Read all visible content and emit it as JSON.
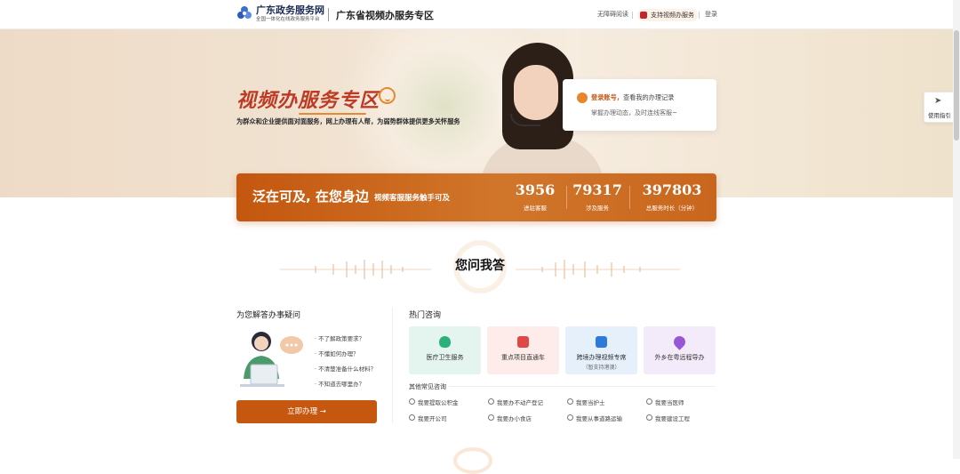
{
  "header": {
    "site_name": "广东政务服务网",
    "site_tagline": "全国一体化在线政务服务平台",
    "zone_title": "广东省视频办服务专区",
    "links": {
      "accessibility": "无障碍阅读",
      "video_support": "支持视频办服务",
      "login": "登录"
    }
  },
  "hero": {
    "title": "视频办服务专区",
    "subtitle": "为群众和企业提供面对面服务，网上办理有人帮，为弱势群体提供更多关怀服务"
  },
  "login_card": {
    "highlight": "登录账号，",
    "line1_rest": "查看我的办理记录",
    "line2": "掌握办理动态，及时连线客服~"
  },
  "stats": {
    "slogan": "泛在可及, 在您身边",
    "tagline": "视频客服服务触手可及",
    "items": [
      {
        "value": "3956",
        "label": "进驻客服"
      },
      {
        "value": "79317",
        "label": "涉及服务"
      },
      {
        "value": "397803",
        "label": "总服务时长（分钟）"
      }
    ]
  },
  "qa": {
    "title": "您问我答",
    "left_heading": "为您解答办事疑问",
    "questions": [
      "不了解政策要求？",
      "不懂如何办理？",
      "不清楚准备什么材料？",
      "不知道去哪里办？"
    ],
    "action_button": "立即办理 →"
  },
  "hot": {
    "heading": "热门咨询",
    "cards": [
      {
        "title": "医疗卫生服务",
        "sub": "",
        "bg": "#e4f4ef",
        "icon_color": "#2bb07a",
        "icon": "medical-shield-icon"
      },
      {
        "title": "重点项目直通车",
        "sub": "",
        "bg": "#fdecea",
        "icon_color": "#e04848",
        "icon": "project-book-icon"
      },
      {
        "title": "跨境办理视频专席",
        "sub": "（暂支持港澳）",
        "bg": "#e6f0fb",
        "icon_color": "#2f7ad9",
        "icon": "crossborder-document-icon"
      },
      {
        "title": "外乡在粤远程导办",
        "sub": "",
        "bg": "#f3ebfa",
        "icon_color": "#9656d6",
        "icon": "location-pin-icon"
      }
    ],
    "other_heading": "其他常见咨询",
    "other_items": [
      "我要提取公积金",
      "我要办不动产登记",
      "我要当护士",
      "我要当医师",
      "我要开公司",
      "我要办小食店",
      "我要从事道路运输",
      "我要建设工程"
    ]
  },
  "side_guide": {
    "label": "使用指引",
    "icon": "send-arrow-icon"
  },
  "colors": {
    "accent": "#c6570f",
    "hero_title": "#bd3b24",
    "orange_light": "#e68a2f"
  }
}
